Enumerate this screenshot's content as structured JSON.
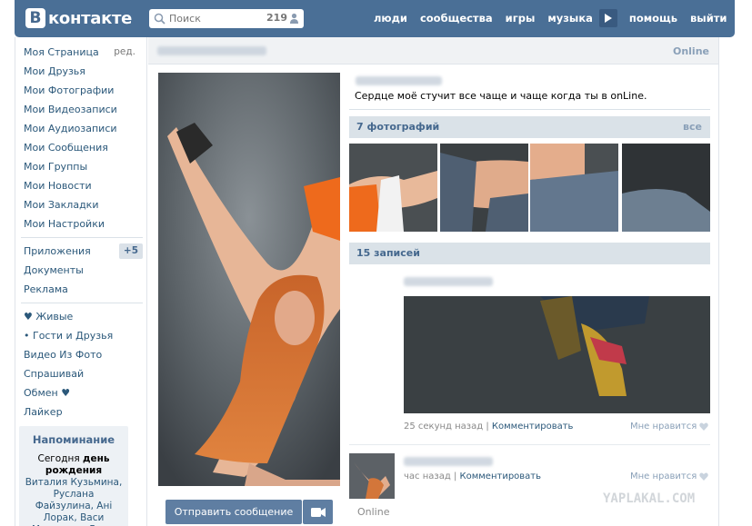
{
  "header": {
    "logo_letter": "В",
    "logo_text": "контакте",
    "search_placeholder": "Поиск",
    "search_count": "219",
    "nav": [
      "люди",
      "сообщества",
      "игры",
      "музыка"
    ],
    "nav_after_play": [
      "помощь",
      "выйти"
    ]
  },
  "sidebar": {
    "items_group1": [
      {
        "label": "Моя Страница",
        "extra": "ред."
      },
      {
        "label": "Мои Друзья"
      },
      {
        "label": "Мои Фотографии"
      },
      {
        "label": "Мои Видеозаписи"
      },
      {
        "label": "Мои Аудиозаписи"
      },
      {
        "label": "Мои Сообщения"
      },
      {
        "label": "Мои Группы"
      },
      {
        "label": "Мои Новости"
      },
      {
        "label": "Мои Закладки"
      },
      {
        "label": "Мои Настройки"
      }
    ],
    "items_group2": [
      {
        "label": "Приложения",
        "badge": "+5"
      },
      {
        "label": "Документы"
      },
      {
        "label": "Реклама"
      }
    ],
    "items_group3": [
      {
        "label": "♥ Живые"
      },
      {
        "label": "• Гости и Друзья"
      },
      {
        "label": "Видео Из Фото"
      },
      {
        "label": "Спрашивай"
      },
      {
        "label": "Обмен ♥"
      },
      {
        "label": "Лайкер"
      }
    ],
    "reminder": {
      "title": "Напоминание",
      "text_pre": "Сегодня",
      "text_day": "день рождения",
      "names": "Виталия Кузьмина, Руслана Файзулина, Ані Лорак, Васи Микитюка, Веры"
    }
  },
  "profile": {
    "online_top": "Online",
    "status": "Сердце моё стучит все чаще и чаще когда ты в onLine.",
    "send_message": "Отправить сообщение",
    "photos_title": "7 фотографий",
    "photos_all": "все",
    "posts_title": "15 записей",
    "post1": {
      "time": "25 секунд назад",
      "separator": "|",
      "comment": "Комментировать",
      "like": "Мне нравится"
    },
    "post2": {
      "time": "час назад",
      "separator": "|",
      "comment": "Комментировать",
      "like": "Мне нравится"
    },
    "online_small": "Online"
  },
  "watermark": "YAPLAKAL.COM",
  "colors": {
    "header": "#4a6f96",
    "link": "#2b587a",
    "section": "#dae2e8",
    "button": "#5f7ea2"
  }
}
